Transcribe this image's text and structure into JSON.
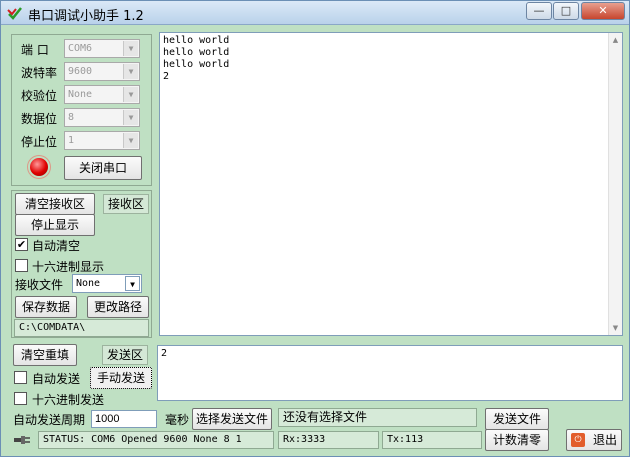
{
  "window": {
    "title": "串口调试小助手 1.2",
    "minimize": "—",
    "maximize": "□",
    "close": "✕"
  },
  "port": {
    "port_label": "端 口",
    "port_value": "COM6",
    "baud_label": "波特率",
    "baud_value": "9600",
    "parity_label": "校验位",
    "parity_value": "None",
    "databits_label": "数据位",
    "databits_value": "8",
    "stopbits_label": "停止位",
    "stopbits_value": "1",
    "close_port_button": "关闭串口"
  },
  "receive": {
    "clear_button": "清空接收区",
    "area_label": "接收区",
    "stop_display_button": "停止显示",
    "auto_clear_label": "自动清空",
    "auto_clear_checked": "✔",
    "hex_display_label": "十六进制显示",
    "file_label": "接收文件",
    "file_value": "None",
    "save_button": "保存数据",
    "change_path_button": "更改路径",
    "path": "C:\\COMDATA\\",
    "text": "hello world\nhello world\nhello world\n2"
  },
  "send": {
    "clear_button": "清空重填",
    "area_label": "发送区",
    "auto_send_label": "自动发送",
    "manual_send_button": "手动发送",
    "hex_send_label": "十六进制发送",
    "period_label": "自动发送周期",
    "period_value": "1000",
    "unit_label": "毫秒",
    "select_file_button": "选择发送文件",
    "file_status": "还没有选择文件",
    "send_file_button": "发送文件",
    "text": "2"
  },
  "status": {
    "text": "STATUS: COM6 Opened 9600 None 8 1",
    "rx": "Rx:3333",
    "tx": "Tx:113",
    "reset_count_button": "计数清零",
    "exit_button": "退出"
  },
  "colors": {
    "background": "#bfe0c3",
    "led": "#e00000"
  }
}
